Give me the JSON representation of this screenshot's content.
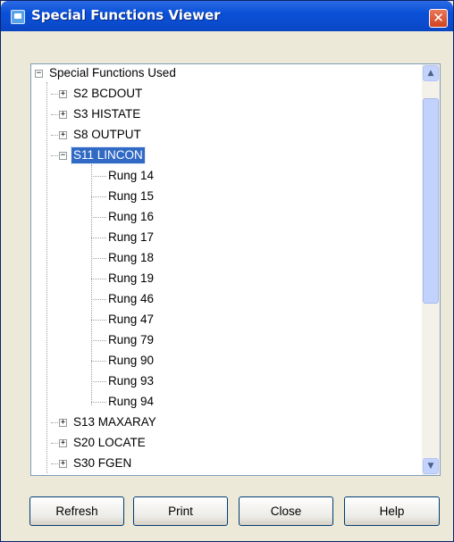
{
  "window": {
    "title": "Special Functions Viewer"
  },
  "tree": {
    "root_label": "Special Functions Used",
    "items_before": [
      "S2 BCDOUT",
      "S3 HISTATE",
      "S8 OUTPUT"
    ],
    "expanded": {
      "label": "S11 LINCON",
      "rungs": [
        "Rung 14",
        "Rung 15",
        "Rung 16",
        "Rung 17",
        "Rung 18",
        "Rung 19",
        "Rung 46",
        "Rung 47",
        "Rung 79",
        "Rung 90",
        "Rung 93",
        "Rung 94"
      ]
    },
    "items_after": [
      "S13 MAXARAY",
      "S20 LOCATE",
      "S30 FGEN"
    ]
  },
  "buttons": {
    "refresh": "Refresh",
    "print": "Print",
    "close": "Close",
    "help": "Help"
  },
  "colors": {
    "selection": "#316AC5",
    "titlebar": "#0A51D8",
    "close_button": "#D2421F",
    "face": "#ECE9D8"
  }
}
